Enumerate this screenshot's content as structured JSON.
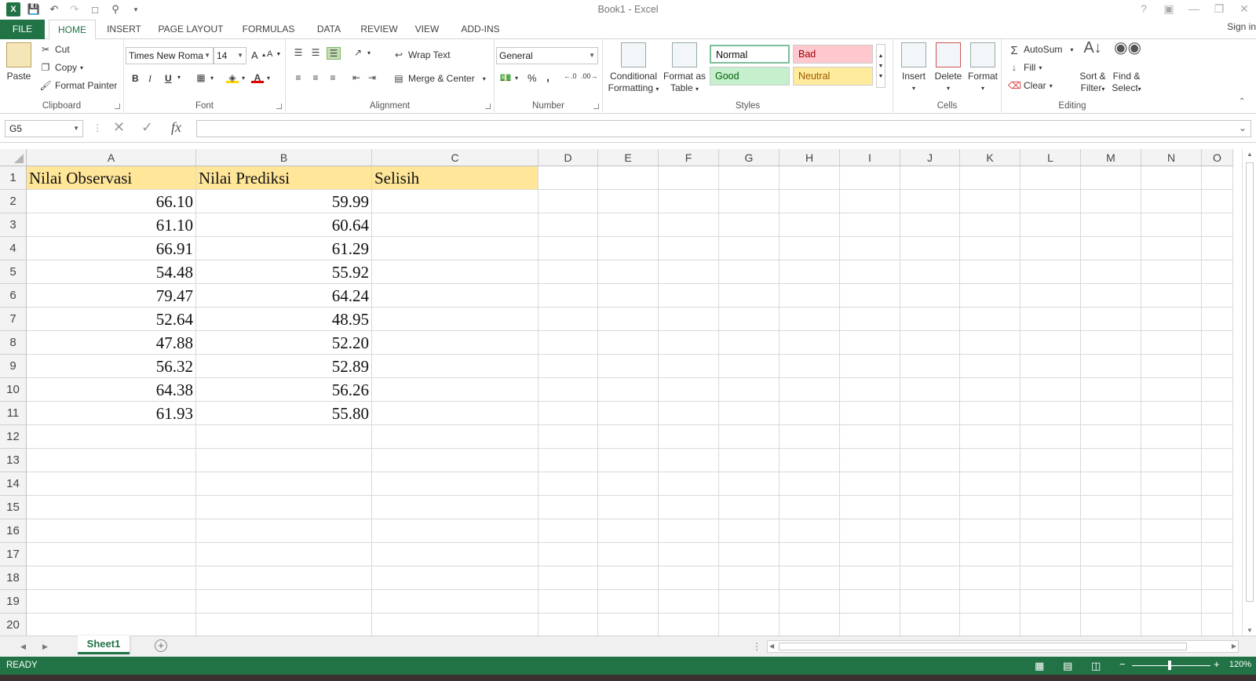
{
  "window": {
    "title": "Book1 - Excel",
    "sign_in": "Sign in"
  },
  "tabs": [
    "FILE",
    "HOME",
    "INSERT",
    "PAGE LAYOUT",
    "FORMULAS",
    "DATA",
    "REVIEW",
    "VIEW",
    "ADD-INS"
  ],
  "active_tab": "HOME",
  "ribbon": {
    "clipboard": {
      "label": "Clipboard",
      "paste": "Paste",
      "cut": "Cut",
      "copy": "Copy",
      "format_painter": "Format Painter"
    },
    "font": {
      "label": "Font",
      "family": "Times New Roma",
      "size": "14",
      "bold": "B",
      "italic": "I",
      "underline": "U"
    },
    "alignment": {
      "label": "Alignment",
      "wrap_text": "Wrap Text",
      "merge_center": "Merge & Center"
    },
    "number": {
      "label": "Number",
      "format": "General",
      "percent": "%",
      "comma": ","
    },
    "styles": {
      "label": "Styles",
      "conditional_1": "Conditional",
      "conditional_2": "Formatting",
      "format_table_1": "Format as",
      "format_table_2": "Table",
      "normal": "Normal",
      "bad": "Bad",
      "good": "Good",
      "neutral": "Neutral"
    },
    "cells": {
      "label": "Cells",
      "insert": "Insert",
      "delete": "Delete",
      "format": "Format"
    },
    "editing": {
      "label": "Editing",
      "autosum": "AutoSum",
      "fill": "Fill",
      "clear": "Clear",
      "sort_1": "Sort &",
      "sort_2": "Filter",
      "find_1": "Find &",
      "find_2": "Select"
    }
  },
  "formula_bar": {
    "name_box": "G5",
    "fx": "fx",
    "value": ""
  },
  "columns": [
    "A",
    "B",
    "C",
    "D",
    "E",
    "F",
    "G",
    "H",
    "I",
    "J",
    "K",
    "L",
    "M",
    "N",
    "O"
  ],
  "rows": [
    "1",
    "2",
    "3",
    "4",
    "5",
    "6",
    "7",
    "8",
    "9",
    "10",
    "11",
    "12",
    "13",
    "14",
    "15",
    "16",
    "17",
    "18",
    "19",
    "20"
  ],
  "sheet": {
    "headers": [
      "Nilai Observasi",
      "Nilai Prediksi",
      "Selisih"
    ],
    "data": [
      [
        "66.10",
        "59.99"
      ],
      [
        "61.10",
        "60.64"
      ],
      [
        "66.91",
        "61.29"
      ],
      [
        "54.48",
        "55.92"
      ],
      [
        "79.47",
        "64.24"
      ],
      [
        "52.64",
        "48.95"
      ],
      [
        "47.88",
        "52.20"
      ],
      [
        "56.32",
        "52.89"
      ],
      [
        "64.38",
        "56.26"
      ],
      [
        "61.93",
        "55.80"
      ]
    ]
  },
  "sheet_tabs": [
    "Sheet1"
  ],
  "status": {
    "text": "READY",
    "zoom": "120%"
  },
  "colors": {
    "excel_green": "#217346",
    "header_fill": "#ffe699"
  }
}
